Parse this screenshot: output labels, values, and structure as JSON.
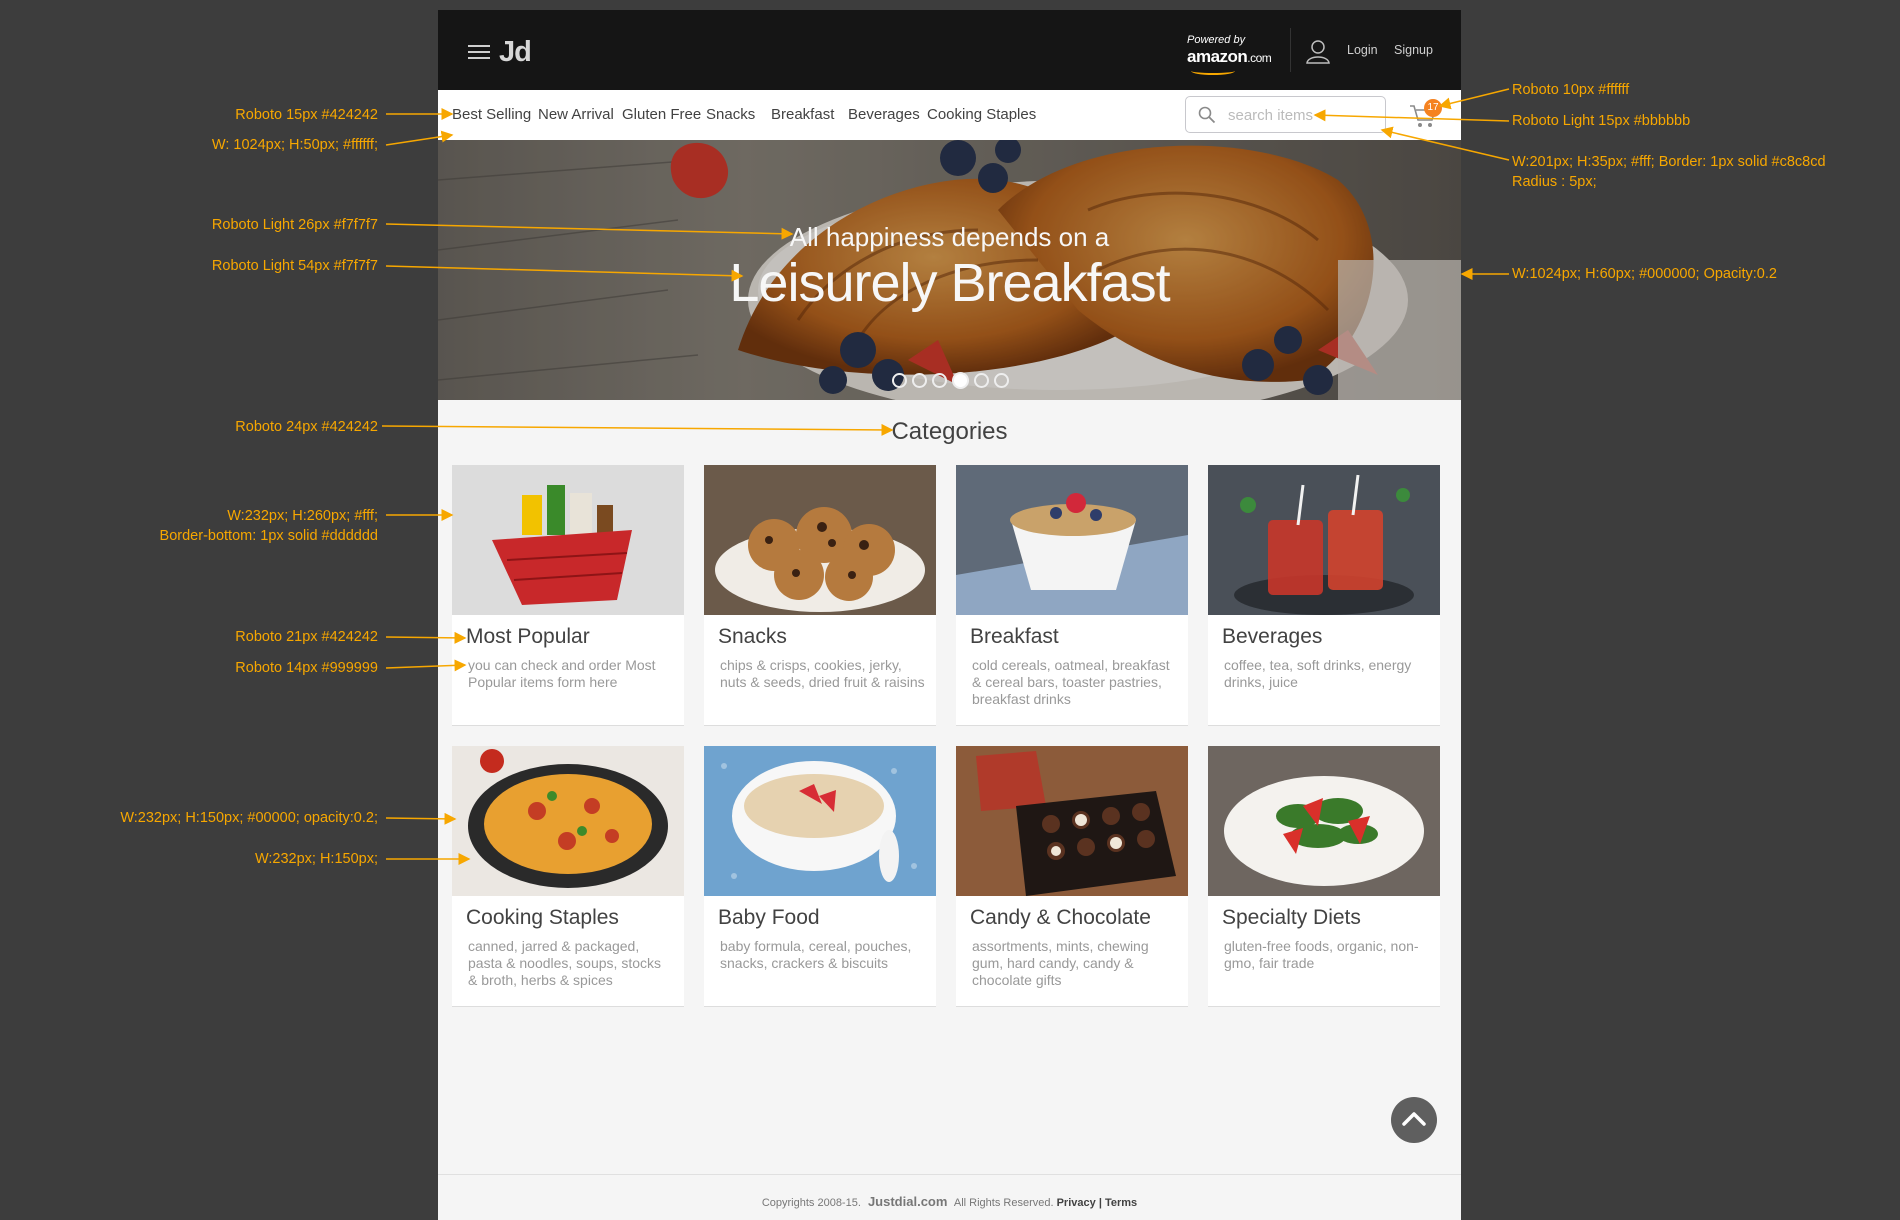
{
  "header": {
    "logo": "Jd",
    "powered_by": "Powered by",
    "amazon": "amazon",
    "amazon_suffix": ".com",
    "login": "Login",
    "signup": "Signup"
  },
  "nav": {
    "items": [
      "Best Selling",
      "New Arrival",
      "Gluten Free",
      "Snacks",
      "Breakfast",
      "Beverages",
      "Cooking Staples"
    ],
    "search_placeholder": "search items",
    "cart_count": "17"
  },
  "hero": {
    "subtitle": "All happiness depends on a",
    "title": "Leisurely Breakfast",
    "slides": 6,
    "active_slide": 4
  },
  "categories": {
    "heading": "Categories",
    "items": [
      {
        "title": "Most Popular",
        "desc": "you can check and order Most Popular items form here"
      },
      {
        "title": "Snacks",
        "desc": "chips & crisps, cookies, jerky, nuts & seeds, dried fruit & raisins"
      },
      {
        "title": "Breakfast",
        "desc": "cold cereals, oatmeal, breakfast & cereal bars, toaster pastries, breakfast drinks"
      },
      {
        "title": "Beverages",
        "desc": "coffee, tea, soft drinks, energy drinks, juice"
      },
      {
        "title": "Cooking Staples",
        "desc": "canned, jarred & packaged, pasta & noodles, soups, stocks & broth, herbs & spices"
      },
      {
        "title": "Baby Food",
        "desc": "baby formula, cereal, pouches, snacks, crackers & biscuits"
      },
      {
        "title": "Candy & Chocolate",
        "desc": "assortments, mints, chewing gum, hard candy, candy & chocolate gifts"
      },
      {
        "title": "Specialty Diets",
        "desc": "gluten-free foods, organic, non-gmo, fair trade"
      }
    ]
  },
  "footer": {
    "copyright": "Copyrights 2008-15.",
    "brand": "Justdial.com",
    "rights": "All Rights Reserved.",
    "privacy": "Privacy",
    "sep": "|",
    "terms": "Terms"
  },
  "annotations": {
    "a1": "Roboto 15px #424242",
    "a2": "W: 1024px; H:50px; #ffffff;",
    "a3": "Roboto Light 26px #f7f7f7",
    "a4": "Roboto Light 54px #f7f7f7",
    "a5": "Roboto 24px #424242",
    "a6": "W:232px; H:260px; #fff;",
    "a6b": "Border-bottom: 1px solid #dddddd",
    "a7": "Roboto 21px #424242",
    "a8": "Roboto 14px #999999",
    "a9": "W:232px; H:150px; #00000; opacity:0.2;",
    "a10": "W:232px; H:150px;",
    "r1": "Roboto 10px #ffffff",
    "r2": "Roboto Light 15px #bbbbbb",
    "r3": "W:201px; H:35px; #fff; Border: 1px solid #c8c8cd",
    "r3b": "Radius : 5px;",
    "r4": "W:1024px; H:60px; #000000; Opacity:0.2"
  },
  "colors": {
    "annotation": "#f7a700",
    "topbar": "#151515",
    "badge": "#f58220",
    "text": "#424242",
    "muted": "#999999"
  }
}
